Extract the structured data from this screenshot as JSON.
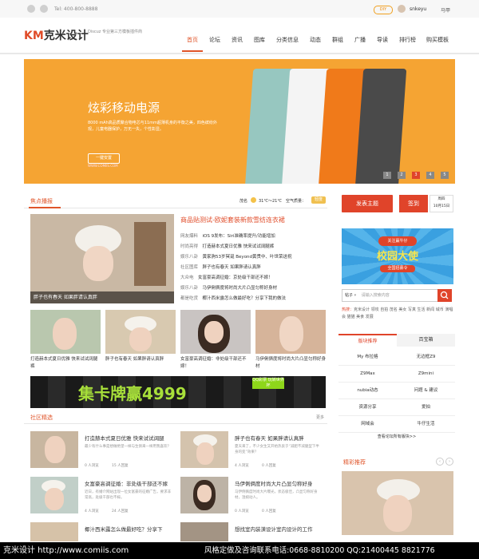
{
  "topbar": {
    "phone": "Tel: 400-800-8888",
    "vip": "DIY",
    "username": "snkeyu",
    "mahjong": "马甲"
  },
  "header": {
    "logo_km": "KM",
    "logo_text": "克米设计",
    "tagline": "Discuz 专业第三方模板插件商",
    "nav": [
      "首页",
      "论坛",
      "资讯",
      "图库",
      "分类信息",
      "动态",
      "群组",
      "广播",
      "导读",
      "排行榜",
      "购买模板"
    ]
  },
  "banner": {
    "title": "炫彩移动电源",
    "subtitle": "8000 mAh高品质聚合物电芯与11mm超薄机身的平衡之美，四色缤纷外观，儿童电器保护，万无一失，个性彰显。",
    "button": "一键安置",
    "url": "WWW.COMIIS.COM",
    "dots": [
      "1",
      "2",
      "3",
      "4",
      "5"
    ],
    "colors": [
      "#97c7c0",
      "#f2f2f2",
      "#f07a1a",
      "#4a4a4a"
    ]
  },
  "hot": {
    "title": "焦点播报",
    "city": "茂名",
    "temp": "31℃～21℃",
    "air": "空气质量：",
    "air_level": "轻度",
    "big_caption": "胖子也有春天 如果胖请认真胖",
    "headline": "商品贴测试-欧妮套装新款雪纺连衣裙",
    "news": [
      {
        "cat": "网友爆料",
        "text": "iOS 9发布：Siri准确率提升/功能增加"
      },
      {
        "cat": "时尚亮得",
        "text": "打造赫本式夏日优雅 快来试试阔腿裤"
      },
      {
        "cat": "娱乐八卦",
        "text": "黄家驹53岁冥诞 Beyond黄贯中、叶世荣送祝"
      },
      {
        "cat": "社区图库",
        "text": "胖子也有春天 如果胖请认真胖"
      },
      {
        "cat": "大众电",
        "text": "女富豪高调征婚：京处级干部还不嫁！"
      },
      {
        "cat": "娱乐八卦",
        "text": "马伊俐俩度将时尚大片凸显匀称好身材"
      },
      {
        "cat": "都是吃货",
        "text": "椰汁西米露怎么做最好吃？分享下我的做法"
      }
    ],
    "thumbs": [
      "打造赫本式夏日优雅 快来试试阔腿裤",
      "胖子也有春天 如果胖请认真胖",
      "女富豪高调征婚：非处级干部还不嫁！",
      "马伊俐俩度将时尚大片凸显匀称好身材"
    ],
    "ad_text": "集卡牌赢4999",
    "ad_badge": "QQ彩票 玩转世界杯"
  },
  "community": {
    "title": "社区精选",
    "more": "更多",
    "posts": [
      {
        "title": "打造赫本式夏日优雅 快来试试阔腿",
        "desc": "最少有什么事是想做绝望一样与生俱来一样用我喜欢？",
        "views": "0 人浏览",
        "replies": "15 人回复"
      },
      {
        "title": "胖子也有春天 如果胖请认真胖",
        "desc": "夏天来了，不少女生又开始热衷于“减肥不减腿型下半身的变”效果？",
        "views": "4 人浏览",
        "replies": "0 人回复"
      },
      {
        "title": "女富豪高调征婚：非处级干部还不嫁",
        "desc": "近日，有婚介网站出现一位女富豪的征婚广告，要求非常高，处级干部也不嫁。",
        "views": "4 人浏览",
        "replies": "24 人回复"
      },
      {
        "title": "马伊俐俩度时尚大片凸显匀称好身",
        "desc": "马伊俐俩度时尚大片曝光，状态极佳，凸显匀称好身材，温婉动人。",
        "views": "0 人浏览",
        "replies": "0 人回复"
      },
      {
        "title": "椰汁西米露怎么做最好吃？分享下",
        "desc": "",
        "views": "",
        "replies": ""
      },
      {
        "title": "想找室内装潢设计室内设计的工作",
        "desc": "",
        "views": "",
        "replies": ""
      }
    ]
  },
  "sidebar": {
    "post_btn": "发表主题",
    "sign_btn": "签到",
    "date_line1": "周四",
    "date_line2": "10月15日",
    "ad_title": "校园大使",
    "ad_top": "关注赢牛仔",
    "ad_sub": "全国招募令",
    "search_type": "帖子",
    "search_placeholder": "请输入搜索内容",
    "hot_label": "热搜：",
    "hot_words": "克米设计 领攻 自拍 茂名 美女 写真 生活 新闻 域币 演唱会 猫猫 美食 发展",
    "tab_a": "版块推荐",
    "tab_b": "百宝箱",
    "grid": [
      "My 布拉格",
      "无边框Z9",
      "Z9Max",
      "Z9mini",
      "nubia动态",
      "问题 & 建议",
      "资源分享",
      "爱拍",
      "网域会",
      "牛仔生活"
    ],
    "more_sections": "查看论坛所有版块>>",
    "fine_title": "精彩推荐"
  },
  "footer": {
    "text": "克米设计 http://www.comiis.com",
    "contact": "风格定做及咨询联系电话:0668-8810200  QQ:21400445 8821776"
  }
}
